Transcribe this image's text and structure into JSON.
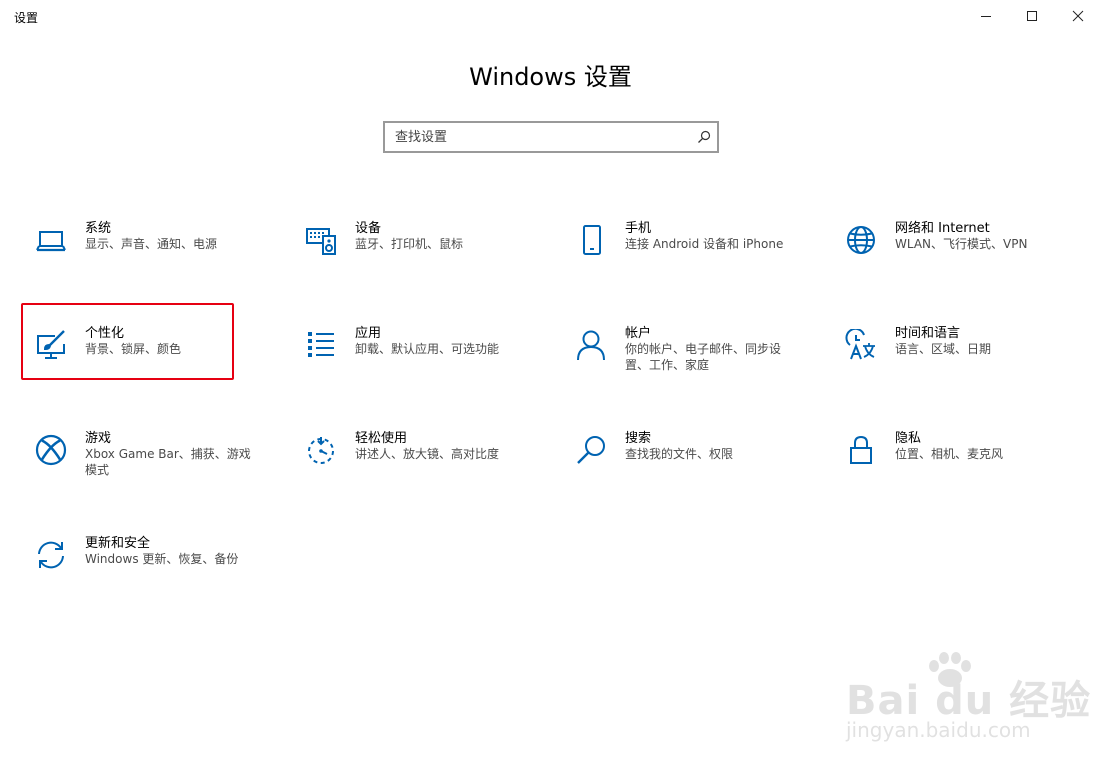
{
  "window": {
    "title": "设置",
    "minimize_icon": "minimize-icon",
    "maximize_icon": "maximize-icon",
    "close_icon": "close-icon"
  },
  "header": {
    "title": "Windows 设置"
  },
  "search": {
    "placeholder": "查找设置",
    "value": "",
    "icon": "search-icon"
  },
  "tiles": [
    {
      "id": "system",
      "title": "系统",
      "desc": "显示、声音、通知、电源",
      "icon": "laptop-icon"
    },
    {
      "id": "devices",
      "title": "设备",
      "desc": "蓝牙、打印机、鼠标",
      "icon": "keyboard-speaker-icon"
    },
    {
      "id": "phone",
      "title": "手机",
      "desc": "连接 Android 设备和 iPhone",
      "icon": "phone-icon"
    },
    {
      "id": "network",
      "title": "网络和 Internet",
      "desc": "WLAN、飞行模式、VPN",
      "icon": "globe-icon"
    },
    {
      "id": "personalization",
      "title": "个性化",
      "desc": "背景、锁屏、颜色",
      "icon": "paintbrush-monitor-icon"
    },
    {
      "id": "apps",
      "title": "应用",
      "desc": "卸载、默认应用、可选功能",
      "icon": "app-list-icon"
    },
    {
      "id": "accounts",
      "title": "帐户",
      "desc": "你的帐户、电子邮件、同步设置、工作、家庭",
      "icon": "person-icon"
    },
    {
      "id": "time-language",
      "title": "时间和语言",
      "desc": "语言、区域、日期",
      "icon": "clock-language-icon"
    },
    {
      "id": "gaming",
      "title": "游戏",
      "desc": "Xbox Game Bar、捕获、游戏模式",
      "icon": "xbox-icon"
    },
    {
      "id": "ease-of-access",
      "title": "轻松使用",
      "desc": "讲述人、放大镜、高对比度",
      "icon": "ease-of-access-icon"
    },
    {
      "id": "search",
      "title": "搜索",
      "desc": "查找我的文件、权限",
      "icon": "magnifier-icon"
    },
    {
      "id": "privacy",
      "title": "隐私",
      "desc": "位置、相机、麦克风",
      "icon": "lock-icon"
    },
    {
      "id": "update-security",
      "title": "更新和安全",
      "desc": "Windows 更新、恢复、备份",
      "icon": "sync-icon"
    }
  ],
  "highlighted_tile": "personalization",
  "watermark": {
    "brand": "Bai du 经验",
    "url": "jingyan.baidu.com"
  },
  "colors": {
    "accent": "#0063b1",
    "highlight_border": "#e60012",
    "text_primary": "#000000",
    "text_secondary": "#4a4a4a",
    "search_border": "#999999",
    "background": "#ffffff"
  }
}
